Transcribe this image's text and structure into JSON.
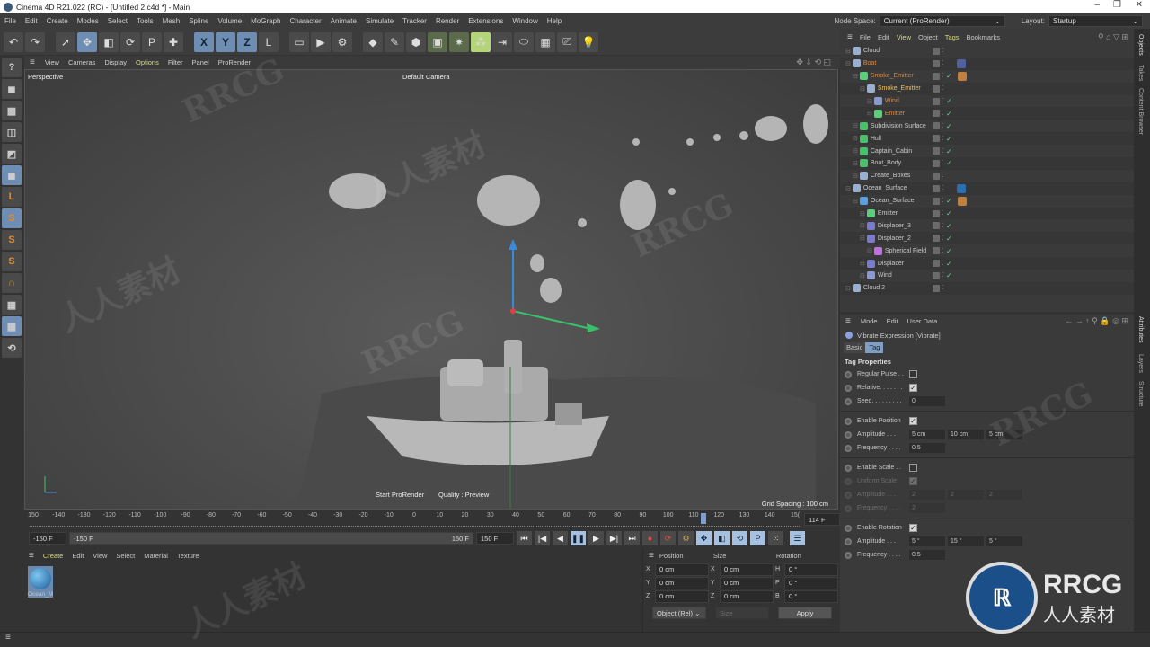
{
  "window": {
    "title": "Cinema 4D R21.022 (RC) - [Untitled 2.c4d *] - Main",
    "controls": [
      "–",
      "❐",
      "✕"
    ]
  },
  "menu": [
    "File",
    "Edit",
    "Create",
    "Modes",
    "Select",
    "Tools",
    "Mesh",
    "Spline",
    "Volume",
    "MoGraph",
    "Character",
    "Animate",
    "Simulate",
    "Tracker",
    "Render",
    "Extensions",
    "Window",
    "Help"
  ],
  "topright": {
    "node_space_label": "Node Space:",
    "node_space_value": "Current (ProRender)",
    "layout_label": "Layout:",
    "layout_value": "Startup"
  },
  "toolbar": {
    "tools": [
      "undo",
      "redo",
      "select",
      "move",
      "scale",
      "rotate",
      "psr",
      "add",
      "x-axis",
      "y-axis",
      "z-axis",
      "coordinate-system",
      "render-region",
      "render-view",
      "render-settings",
      "cube",
      "pen",
      "subdivision",
      "extrude",
      "deformer",
      "cloner",
      "mirror",
      "field",
      "floor",
      "camera",
      "light"
    ],
    "axis_labels": [
      "X",
      "Y",
      "Z"
    ]
  },
  "left_tools": [
    "make-editable",
    "model-mode",
    "texture-mode",
    "point-mode",
    "edge-mode",
    "polygon-mode",
    "axis-mode",
    "snap-s1",
    "snap-s2",
    "snap-s3",
    "magnet",
    "grid",
    "workplane-lock",
    "workplane-rotate"
  ],
  "viewport": {
    "menu": [
      "View",
      "Cameras",
      "Display",
      "Options",
      "Filter",
      "Panel",
      "ProRender"
    ],
    "view_name": "Perspective",
    "camera": "Default Camera",
    "start_prorender": "Start ProRender",
    "quality": "Quality : Preview",
    "grid_spacing": "Grid Spacing : 100 cm"
  },
  "timeline": {
    "ticks": [
      "150",
      "-140",
      "-130",
      "-120",
      "-110",
      "-100",
      "-90",
      "-80",
      "-70",
      "-60",
      "-50",
      "-40",
      "-30",
      "-20",
      "-10",
      "0",
      "10",
      "20",
      "30",
      "40",
      "50",
      "60",
      "70",
      "80",
      "90",
      "100",
      "110",
      "120",
      "130",
      "140",
      "15("
    ],
    "current_frame": "114 F",
    "current_frame_value": 114,
    "min": -150,
    "max": 150
  },
  "playbar": {
    "start_field": "-150 F",
    "range_start": "-150 F",
    "range_end": "150 F",
    "end_field": "150 F"
  },
  "material_manager": {
    "menu": [
      "Create",
      "Edit",
      "View",
      "Select",
      "Material",
      "Texture"
    ],
    "materials": [
      {
        "name": "Ocean_M"
      }
    ]
  },
  "coordinates": {
    "headers": [
      "Position",
      "Size",
      "Rotation"
    ],
    "rows": [
      {
        "pl": "X",
        "p": "0 cm",
        "sl": "X",
        "s": "0 cm",
        "rl": "H",
        "r": "0 °"
      },
      {
        "pl": "Y",
        "p": "0 cm",
        "sl": "Y",
        "s": "0 cm",
        "rl": "P",
        "r": "0 °"
      },
      {
        "pl": "Z",
        "p": "0 cm",
        "sl": "Z",
        "s": "0 cm",
        "rl": "B",
        "r": "0 °"
      }
    ],
    "mode": "Object (Rel)",
    "size_mode": "Size",
    "apply": "Apply"
  },
  "object_manager": {
    "menu": [
      "File",
      "Edit",
      "View",
      "Object",
      "Tags",
      "Bookmarks"
    ],
    "objects": [
      {
        "name": "Cloud",
        "depth": 0,
        "color": "#c8c8c8",
        "icon": "null",
        "check": false
      },
      {
        "name": "Boat",
        "depth": 0,
        "color": "#d58a4a",
        "icon": "null",
        "check": false,
        "tag": "vibrate"
      },
      {
        "name": "Smoke_Emitter",
        "depth": 1,
        "color": "#d58a4a",
        "icon": "emitter",
        "check": true,
        "tag": "phong"
      },
      {
        "name": "Smoke_Emitter",
        "depth": 2,
        "color": "#f0c060",
        "icon": "null",
        "check": false
      },
      {
        "name": "Wind",
        "depth": 3,
        "color": "#d58a4a",
        "icon": "wind",
        "check": true
      },
      {
        "name": "Emitter",
        "depth": 3,
        "color": "#d58a4a",
        "icon": "emitter",
        "check": true
      },
      {
        "name": "Subdivision Surface",
        "depth": 1,
        "color": "#c8c8c8",
        "icon": "subd",
        "check": true
      },
      {
        "name": "Hull",
        "depth": 1,
        "color": "#c8c8c8",
        "icon": "subd",
        "check": true
      },
      {
        "name": "Captain_Cabin",
        "depth": 1,
        "color": "#c8c8c8",
        "icon": "subd",
        "check": true
      },
      {
        "name": "Boat_Body",
        "depth": 1,
        "color": "#c8c8c8",
        "icon": "subd",
        "check": true
      },
      {
        "name": "Create_Boxes",
        "depth": 1,
        "color": "#c8c8c8",
        "icon": "null",
        "check": false
      },
      {
        "name": "Ocean_Surface",
        "depth": 0,
        "color": "#c8c8c8",
        "icon": "null",
        "check": false,
        "tag": "material"
      },
      {
        "name": "Ocean_Surface",
        "depth": 1,
        "color": "#c8c8c8",
        "icon": "plane",
        "check": true,
        "tag": "phong"
      },
      {
        "name": "Emitter",
        "depth": 2,
        "color": "#c8c8c8",
        "icon": "emitter",
        "check": true
      },
      {
        "name": "Displacer_3",
        "depth": 2,
        "color": "#c8c8c8",
        "icon": "displacer",
        "check": true
      },
      {
        "name": "Displacer_2",
        "depth": 2,
        "color": "#c8c8c8",
        "icon": "displacer",
        "check": true
      },
      {
        "name": "Spherical Field",
        "depth": 3,
        "color": "#c8c8c8",
        "icon": "field",
        "check": true
      },
      {
        "name": "Displacer",
        "depth": 2,
        "color": "#c8c8c8",
        "icon": "displacer",
        "check": true
      },
      {
        "name": "Wind",
        "depth": 2,
        "color": "#c8c8c8",
        "icon": "wind",
        "check": true
      },
      {
        "name": "Cloud 2",
        "depth": 0,
        "color": "#c8c8c8",
        "icon": "null",
        "check": false
      }
    ]
  },
  "attributes": {
    "menu": [
      "Mode",
      "Edit",
      "User Data"
    ],
    "object_title": "Vibrate Expression [Vibrate]",
    "tabs": [
      "Basic",
      "Tag"
    ],
    "active_tab": "Tag",
    "section": "Tag Properties",
    "fields": [
      {
        "label": "Regular Pulse . .",
        "type": "check",
        "value": false
      },
      {
        "label": "Relative. . . . . . .",
        "type": "check",
        "value": true
      },
      {
        "label": "Seed. . . . . . . . .",
        "type": "num",
        "values": [
          "0"
        ]
      },
      {
        "sep": true
      },
      {
        "label": "Enable Position",
        "type": "check",
        "value": true
      },
      {
        "label": "Amplitude . . . .",
        "type": "num",
        "values": [
          "5 cm",
          "10 cm",
          "5 cm"
        ]
      },
      {
        "label": "Frequency . . . .",
        "type": "num",
        "values": [
          "0.5"
        ]
      },
      {
        "sep": true
      },
      {
        "label": "Enable Scale . .",
        "type": "check",
        "value": false
      },
      {
        "label": "Uniform Scale",
        "type": "check",
        "value": true,
        "disabled": true
      },
      {
        "label": "Amplitude . . . .",
        "type": "num",
        "values": [
          "2",
          "2",
          "2"
        ],
        "disabled": true
      },
      {
        "label": "Frequency . . . .",
        "type": "num",
        "values": [
          "2"
        ],
        "disabled": true
      },
      {
        "sep": true
      },
      {
        "label": "Enable Rotation",
        "type": "check",
        "value": true
      },
      {
        "label": "Amplitude . . . .",
        "type": "num",
        "values": [
          "5 °",
          "15 °",
          "5 °"
        ]
      },
      {
        "label": "Frequency . . . .",
        "type": "num",
        "values": [
          "0.5"
        ]
      }
    ]
  },
  "right_tabs": {
    "top": [
      "Objects",
      "Takes",
      "Content Browser"
    ],
    "bottom": [
      "Attributes",
      "Layers",
      "Structure"
    ]
  },
  "watermarks": [
    "RRCG",
    "人人素材"
  ],
  "brand": {
    "name": "RRCG",
    "sub": "人人素材"
  }
}
